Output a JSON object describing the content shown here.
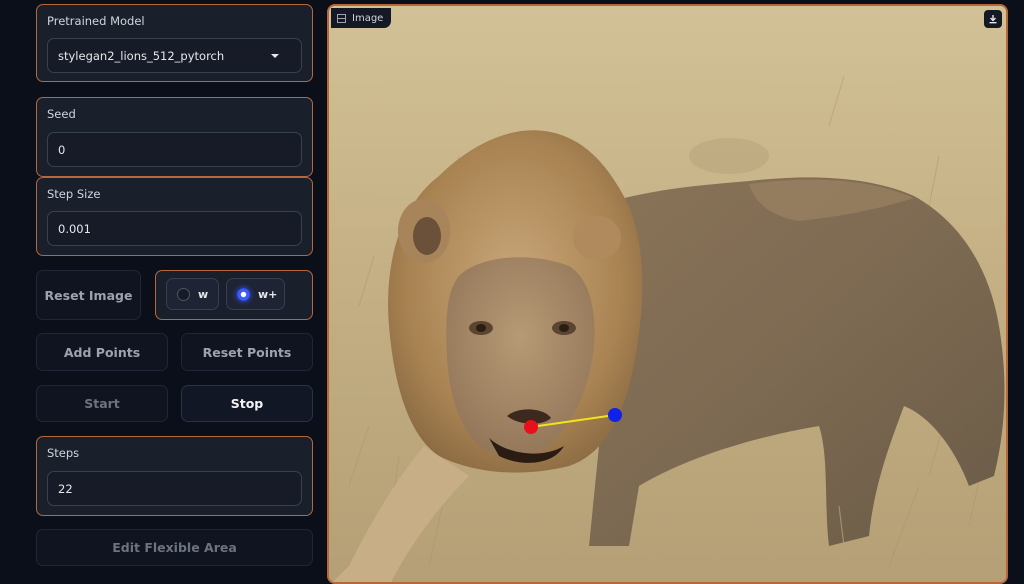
{
  "controls": {
    "pretrained_model": {
      "label": "Pretrained Model",
      "selected": "stylegan2_lions_512_pytorch"
    },
    "seed": {
      "label": "Seed",
      "value": "0"
    },
    "step_size": {
      "label": "Step Size",
      "value": "0.001"
    },
    "reset_image_label": "Reset Image",
    "latent_space": {
      "options": [
        "w",
        "w+"
      ],
      "selected": "w+"
    },
    "add_points_label": "Add Points",
    "reset_points_label": "Reset Points",
    "start_label": "Start",
    "stop_label": "Stop",
    "steps": {
      "label": "Steps",
      "value": "22"
    },
    "edit_flexible_area_label": "Edit Flexible Area"
  },
  "image_panel": {
    "label": "Image",
    "icons": {
      "tag": "image-icon",
      "download": "download-icon"
    },
    "points": {
      "handle": {
        "color": "#e8101c"
      },
      "target": {
        "color": "#1022e8"
      },
      "line_color": "#f2e21a"
    }
  },
  "colors": {
    "background": "#0b0f19",
    "panel": "#1a1f2c",
    "accent_border": "#b7673a"
  }
}
